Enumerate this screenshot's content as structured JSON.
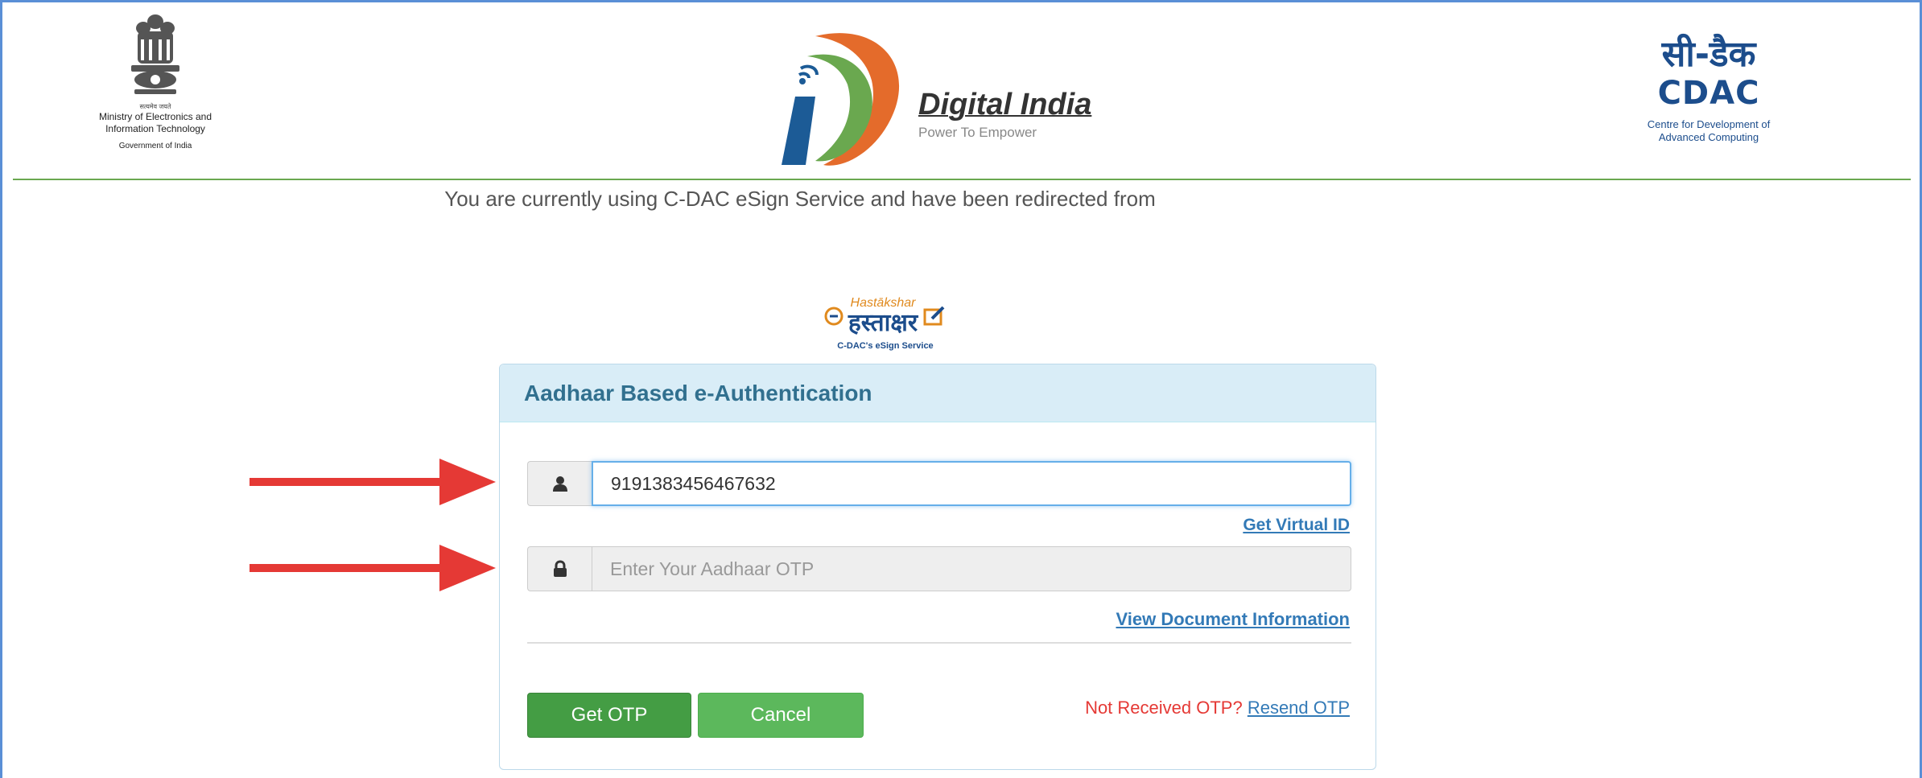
{
  "header": {
    "gov": {
      "tagline": "सत्यमेव जयते",
      "line1": "Ministry of Electronics and",
      "line2": "Information Technology",
      "line3": "Government of India"
    },
    "digital_india": {
      "title": "Digital India",
      "subtitle": "Power To Empower"
    },
    "cdac": {
      "hindi": "सी-डैक",
      "logo_text": "CDAC",
      "line1": "Centre for Development of",
      "line2": "Advanced Computing"
    }
  },
  "redirect_notice": "You are currently using C-DAC eSign Service and have been redirected from",
  "esign_logo": {
    "english": "Hastākshar",
    "hindi": "हस्ताक्षर",
    "caption": "C-DAC's eSign Service"
  },
  "panel": {
    "title": "Aadhaar Based e-Authentication",
    "aadhaar_field": {
      "value": "9191383456467632",
      "icon": "user-icon"
    },
    "virtual_id_link": "Get Virtual ID",
    "otp_field": {
      "placeholder": "Enter Your Aadhaar OTP",
      "icon": "lock-icon"
    },
    "view_doc_link": "View Document Information",
    "buttons": {
      "get_otp": "Get OTP",
      "cancel": "Cancel"
    },
    "not_received": "Not Received OTP?",
    "resend": "Resend OTP"
  },
  "colors": {
    "panel_header_bg": "#d9edf7",
    "panel_title": "#31708f",
    "link": "#337ab7",
    "button_green": "#449d44",
    "alert_red": "#e53935",
    "arrow_red": "#e53935"
  }
}
